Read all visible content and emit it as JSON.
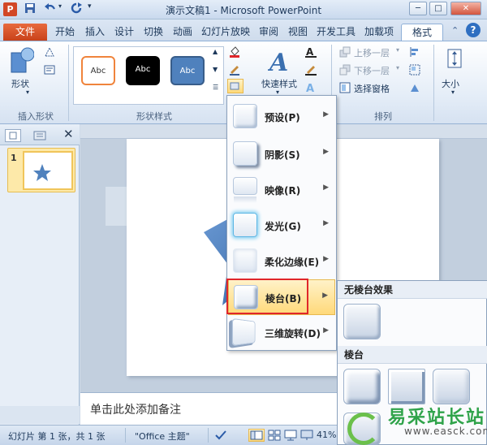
{
  "window": {
    "title": "演示文稿1 - Microsoft PowerPoint",
    "app_logo": "P",
    "min_label": "─",
    "max_label": "□",
    "close_label": "✕"
  },
  "tabs": [
    {
      "label": "文件"
    },
    {
      "label": "开始"
    },
    {
      "label": "插入"
    },
    {
      "label": "设计"
    },
    {
      "label": "切换"
    },
    {
      "label": "动画"
    },
    {
      "label": "幻灯片放映"
    },
    {
      "label": "审阅"
    },
    {
      "label": "视图"
    },
    {
      "label": "开发工具"
    },
    {
      "label": "加载项"
    },
    {
      "label": "格式"
    }
  ],
  "ribbon": {
    "insert_shapes": {
      "shape_btn": "形状",
      "label": "插入形状"
    },
    "shape_styles": {
      "label": "形状样式",
      "styles": [
        "Abc",
        "Abc",
        "Abc"
      ]
    },
    "art_styles": {
      "quick_styles": "快速样式"
    },
    "arrange": {
      "bring_forward": "上移一层",
      "send_backward": "下移一层",
      "selection_pane": "选择窗格",
      "label": "排列"
    },
    "size": {
      "label": "大小"
    }
  },
  "menu": {
    "items": [
      {
        "label": "预设(P)"
      },
      {
        "label": "阴影(S)"
      },
      {
        "label": "映像(R)"
      },
      {
        "label": "发光(G)"
      },
      {
        "label": "柔化边缘(E)"
      },
      {
        "label": "棱台(B)"
      },
      {
        "label": "三维旋转(D)"
      }
    ]
  },
  "submenu": {
    "no_bevel": "无棱台效果",
    "bevel": "棱台"
  },
  "slide_panel": {
    "slide_number": "1"
  },
  "notes": {
    "placeholder": "单击此处添加备注"
  },
  "status": {
    "slide_info": "幻灯片 第 1 张，共 1 张",
    "theme": "\"Office 主题\"",
    "zoom": "41%"
  },
  "watermark": {
    "text": "易采站长站",
    "url": "www.easck.com"
  },
  "colors": {
    "file_tab": "#d24726",
    "highlight_border": "#e0262a",
    "star": "#4f81bd"
  }
}
